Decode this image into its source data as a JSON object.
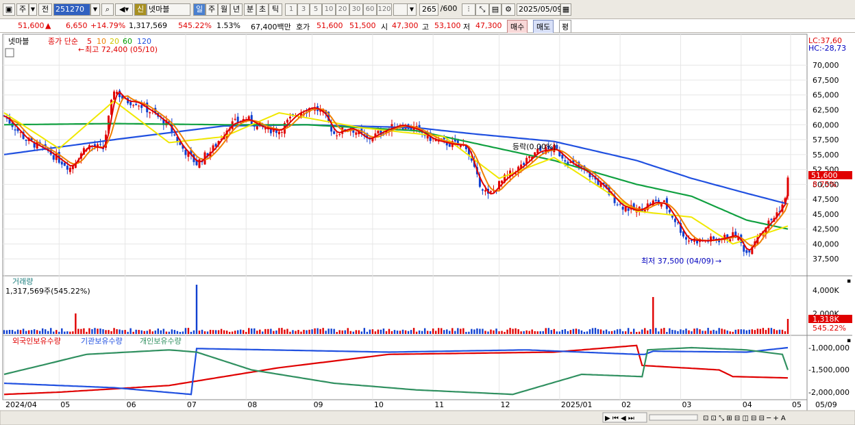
{
  "toolbar": {
    "period_jumin": "주",
    "prev": "전",
    "code": "251270",
    "credit": "신",
    "name": "넷마블",
    "periods": [
      "일",
      "주",
      "월",
      "년",
      "분",
      "초",
      "틱"
    ],
    "intervals": [
      "1",
      "3",
      "5",
      "10",
      "20",
      "30",
      "60",
      "120"
    ],
    "count": "265",
    "count_max": "/600",
    "date": "2025/05/09"
  },
  "info": {
    "price": "51,600",
    "change": "6,650",
    "change_pct": "+14.79%",
    "volume": "1,317,569",
    "vol_ratio": "545.22%",
    "turnover": "1.53%",
    "amount": "67,400백만",
    "quote_label": "호가",
    "ask": "51,600",
    "bid": "51,500",
    "open_label": "시",
    "open": "47,300",
    "high_label": "고",
    "high": "53,100",
    "low_label": "저",
    "low": "47,300",
    "buy": "매수",
    "sell": "매도",
    "avg": "평"
  },
  "price_panel": {
    "stock": "넷마블",
    "legend_prefix": "종가 단순",
    "ma": [
      {
        "p": "5",
        "c": "#e00000"
      },
      {
        "p": "10",
        "c": "#f08000"
      },
      {
        "p": "20",
        "c": "#e8e000"
      },
      {
        "p": "60",
        "c": "#00a000"
      },
      {
        "p": "120",
        "c": "#2050e0"
      }
    ],
    "high_note": "최고 72,400 (05/10)",
    "low_note": "최저 37,500 (04/09)",
    "mid_note": "등락(0.00%)",
    "lc": "LC:37,60",
    "hc": "HC:-28,73",
    "cur_price": "51,600",
    "cur_pct": "8.75%"
  },
  "volume_panel": {
    "title": "거래량",
    "value": "1,317,569주(545.22%)",
    "cur": "1,318K",
    "cur_pct": "545.22%"
  },
  "holding_panel": {
    "s1": "외국인보유수량",
    "s2": "기관보유수량",
    "s3": "개인보유수량"
  },
  "chart_data": [
    {
      "type": "candlestick",
      "title": "넷마블",
      "ylim": [
        35000,
        74500
      ],
      "yticks": [
        "70,000",
        "67,500",
        "65,000",
        "62,500",
        "60,000",
        "57,500",
        "55,000",
        "52,500",
        "50,000",
        "47,500",
        "45,000",
        "42,500",
        "40,000",
        "37,500"
      ],
      "xlabels": [
        "2024/04",
        "05",
        "06",
        "07",
        "08",
        "09",
        "10",
        "11",
        "12",
        "2025/01",
        "02",
        "03",
        "04",
        "05",
        "05/09"
      ],
      "close_path": [
        [
          0,
          61500
        ],
        [
          8,
          57500
        ],
        [
          16,
          55500
        ],
        [
          24,
          52800
        ],
        [
          30,
          56500
        ],
        [
          36,
          56000
        ],
        [
          40,
          66000
        ],
        [
          44,
          64000
        ],
        [
          48,
          63800
        ],
        [
          54,
          62000
        ],
        [
          60,
          59800
        ],
        [
          64,
          56500
        ],
        [
          70,
          53500
        ],
        [
          76,
          56000
        ],
        [
          82,
          60000
        ],
        [
          88,
          61000
        ],
        [
          94,
          59500
        ],
        [
          100,
          59000
        ],
        [
          106,
          61800
        ],
        [
          112,
          63000
        ],
        [
          116,
          62000
        ],
        [
          120,
          58500
        ],
        [
          126,
          59500
        ],
        [
          132,
          57500
        ],
        [
          138,
          59000
        ],
        [
          144,
          60000
        ],
        [
          150,
          59200
        ],
        [
          156,
          57500
        ],
        [
          162,
          56800
        ],
        [
          168,
          56500
        ],
        [
          172,
          51000
        ],
        [
          176,
          48000
        ],
        [
          182,
          51000
        ],
        [
          188,
          53000
        ],
        [
          194,
          55500
        ],
        [
          200,
          56000
        ],
        [
          206,
          53500
        ],
        [
          212,
          52000
        ],
        [
          218,
          49500
        ],
        [
          224,
          46500
        ],
        [
          230,
          45500
        ],
        [
          236,
          47000
        ],
        [
          240,
          46800
        ],
        [
          244,
          44000
        ],
        [
          248,
          40800
        ],
        [
          254,
          40500
        ],
        [
          260,
          40800
        ],
        [
          266,
          41500
        ],
        [
          270,
          38500
        ],
        [
          274,
          41500
        ],
        [
          280,
          44500
        ],
        [
          284,
          47300
        ],
        [
          285,
          51600
        ]
      ],
      "ma_paths": {
        "ma120": [
          [
            0,
            55000
          ],
          [
            40,
            57500
          ],
          [
            80,
            59800
          ],
          [
            110,
            60000
          ],
          [
            150,
            59500
          ],
          [
            170,
            58500
          ],
          [
            200,
            57200
          ],
          [
            230,
            54000
          ],
          [
            250,
            51000
          ],
          [
            270,
            48500
          ],
          [
            285,
            46700
          ]
        ],
        "ma60": [
          [
            0,
            60000
          ],
          [
            40,
            60200
          ],
          [
            80,
            60000
          ],
          [
            110,
            60000
          ],
          [
            150,
            59000
          ],
          [
            170,
            57000
          ],
          [
            200,
            54000
          ],
          [
            230,
            50000
          ],
          [
            250,
            48000
          ],
          [
            270,
            44000
          ],
          [
            285,
            42500
          ]
        ],
        "ma20": [
          [
            0,
            62000
          ],
          [
            20,
            56000
          ],
          [
            40,
            64000
          ],
          [
            60,
            57000
          ],
          [
            80,
            58000
          ],
          [
            100,
            62000
          ],
          [
            130,
            59500
          ],
          [
            160,
            58000
          ],
          [
            180,
            51000
          ],
          [
            200,
            54500
          ],
          [
            230,
            45500
          ],
          [
            250,
            44500
          ],
          [
            265,
            40000
          ],
          [
            285,
            43000
          ]
        ]
      }
    },
    {
      "type": "bar",
      "title": "거래량",
      "yticks": [
        "4,000K",
        "2,000K"
      ],
      "last": "1,318K"
    },
    {
      "type": "line",
      "title": "보유수량",
      "yticks": [
        "-1,000,000",
        "-1,500,000",
        "-2,000,000"
      ],
      "series": [
        {
          "name": "외국인보유수량",
          "color": "#e00000"
        },
        {
          "name": "기관보유수량",
          "color": "#2050e0"
        },
        {
          "name": "개인보유수량",
          "color": "#309060"
        }
      ]
    }
  ]
}
